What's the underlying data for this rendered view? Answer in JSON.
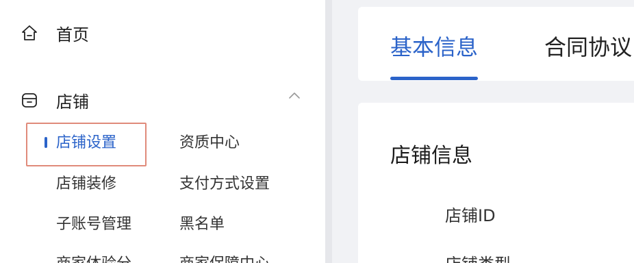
{
  "sidebar": {
    "home": {
      "label": "首页",
      "icon": "home-icon"
    },
    "shop": {
      "label": "店铺",
      "icon": "store-icon",
      "expanded": true,
      "sub_items": [
        {
          "label": "店铺设置",
          "active": true
        },
        {
          "label": "资质中心"
        },
        {
          "label": "店铺装修"
        },
        {
          "label": "支付方式设置"
        },
        {
          "label": "子账号管理"
        },
        {
          "label": "黑名单"
        },
        {
          "label": "商家体验分"
        },
        {
          "label": "商家保障中心"
        }
      ]
    }
  },
  "main": {
    "tabs": [
      {
        "label": "基本信息",
        "active": true
      },
      {
        "label": "合同协议"
      }
    ],
    "section_title": "店铺信息",
    "fields": [
      {
        "label": "店铺ID"
      },
      {
        "label": "店铺类型"
      }
    ]
  },
  "colors": {
    "accent": "#2b63c9",
    "highlight_frame": "#e08a7a",
    "background": "#f1f2f5"
  }
}
